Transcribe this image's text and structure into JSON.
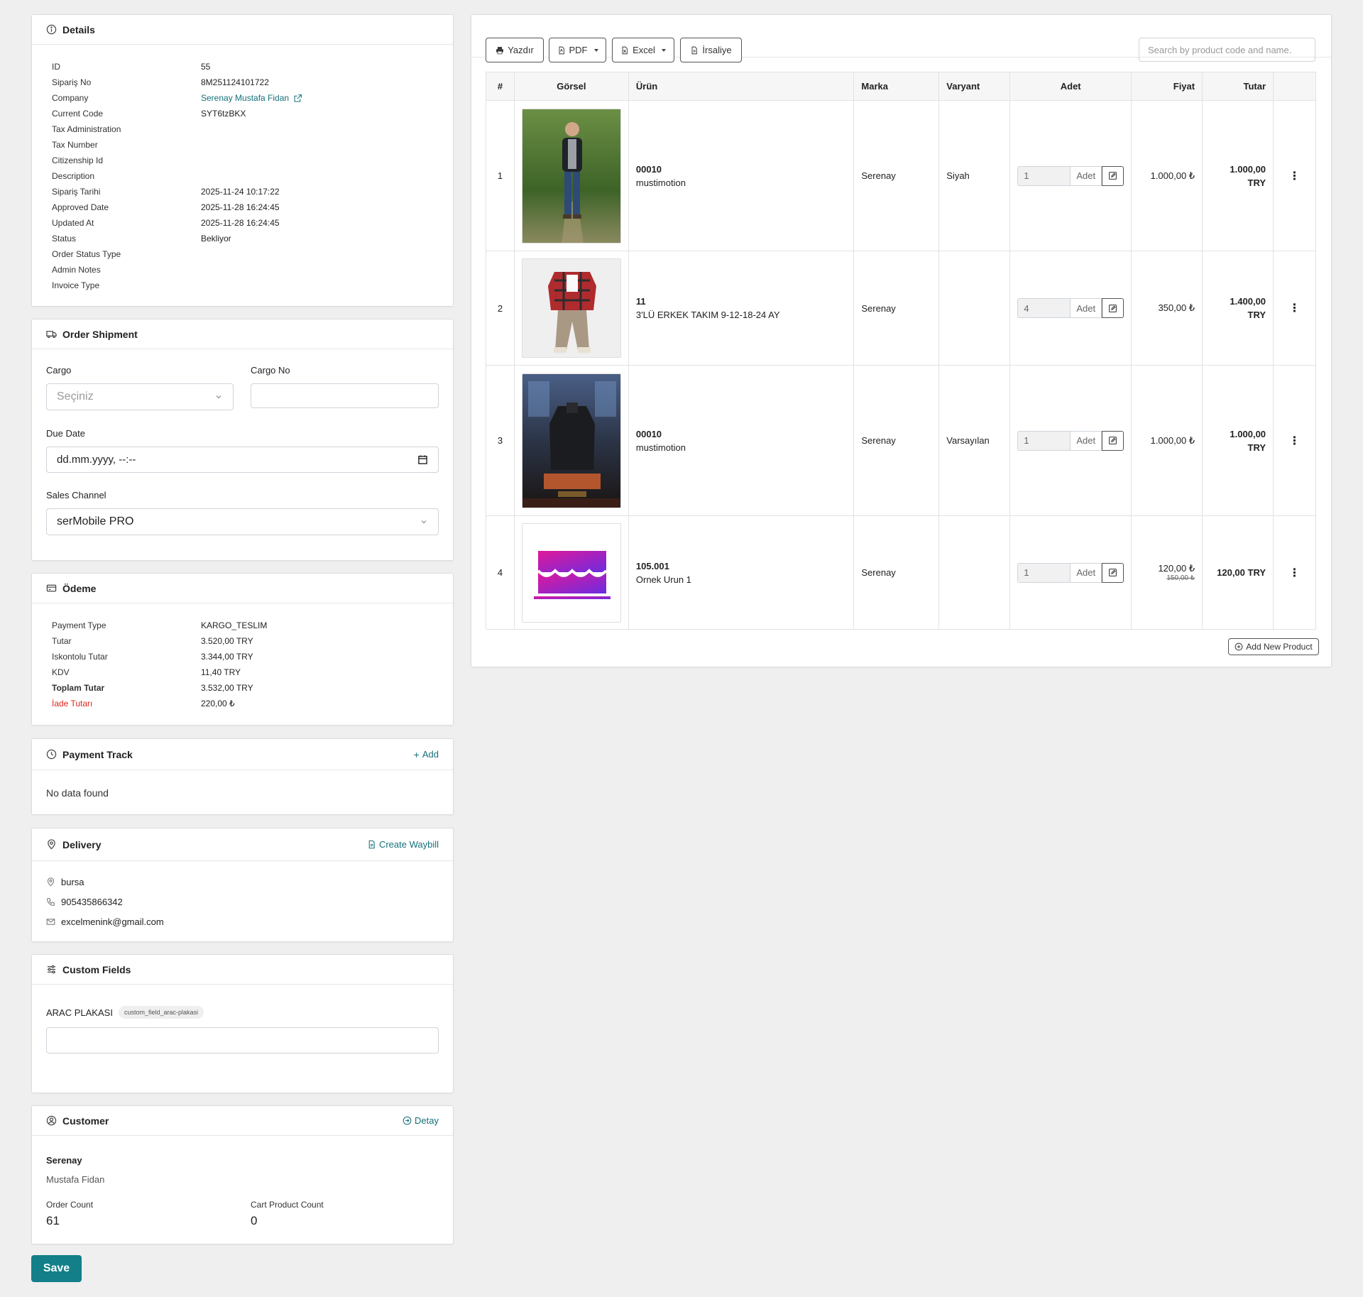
{
  "details": {
    "title": "Details",
    "rows": [
      {
        "key": "ID",
        "value": "55"
      },
      {
        "key": "Sipariş No",
        "value": "8M251124101722"
      },
      {
        "key": "Company",
        "value": "Serenay Mustafa Fidan"
      },
      {
        "key": "Current Code",
        "value": "SYT6tzBKX"
      },
      {
        "key": "Tax Administration",
        "value": ""
      },
      {
        "key": "Tax Number",
        "value": ""
      },
      {
        "key": "Citizenship Id",
        "value": ""
      },
      {
        "key": "Description",
        "value": ""
      },
      {
        "key": "Sipariş Tarihi",
        "value": "2025-11-24 10:17:22"
      },
      {
        "key": "Approved Date",
        "value": "2025-11-28 16:24:45"
      },
      {
        "key": "Updated At",
        "value": "2025-11-28 16:24:45"
      },
      {
        "key": "Status",
        "value": "Bekliyor"
      },
      {
        "key": "Order Status Type",
        "value": ""
      },
      {
        "key": "Admin Notes",
        "value": ""
      },
      {
        "key": "Invoice Type",
        "value": ""
      }
    ]
  },
  "shipment": {
    "title": "Order Shipment",
    "cargo_label": "Cargo",
    "cargo_placeholder": "Seçiniz",
    "cargo_no_label": "Cargo No",
    "cargo_no_value": "",
    "due_date_label": "Due Date",
    "due_date_value": "dd.mm.yyyy, --:--",
    "sales_channel_label": "Sales Channel",
    "sales_channel_value": "serMobile PRO"
  },
  "payment": {
    "title": "Ödeme",
    "rows": [
      {
        "key": "Payment Type",
        "value": "KARGO_TESLIM"
      },
      {
        "key": "Tutar",
        "value": "3.520,00 TRY"
      },
      {
        "key": "Iskontolu Tutar",
        "value": "3.344,00 TRY"
      },
      {
        "key": "KDV",
        "value": "11,40 TRY"
      },
      {
        "key": "Toplam Tutar",
        "value": "3.532,00 TRY"
      },
      {
        "key": "İade Tutarı",
        "value": "220,00 ₺"
      }
    ]
  },
  "payment_track": {
    "title": "Payment Track",
    "add_label": "Add",
    "empty": "No data found"
  },
  "delivery": {
    "title": "Delivery",
    "waybill_label": "Create Waybill",
    "city": "bursa",
    "phone": "905435866342",
    "email": "excelmenink@gmail.com"
  },
  "custom_fields": {
    "title": "Custom Fields",
    "field_label": "ARAC PLAKASI",
    "field_key": "custom_field_arac-plakasi",
    "field_value": ""
  },
  "customer": {
    "title": "Customer",
    "detail_label": "Detay",
    "first_name": "Serenay",
    "last_name": "Mustafa Fidan",
    "order_count_label": "Order Count",
    "order_count": "61",
    "cart_count_label": "Cart Product Count",
    "cart_count": "0"
  },
  "save_label": "Save",
  "toolbar": {
    "print": "Yazdır",
    "pdf": "PDF",
    "excel": "Excel",
    "irsaliye": "İrsaliye",
    "search_placeholder": "Search by product code and name."
  },
  "table": {
    "headers": [
      "#",
      "Görsel",
      "Ürün",
      "Marka",
      "Varyant",
      "Adet",
      "Fiyat",
      "Tutar",
      ""
    ],
    "unit_label": "Adet",
    "rows": [
      {
        "no": "1",
        "code": "00010",
        "name": "mustimotion",
        "brand": "Serenay",
        "variant": "Siyah",
        "qty": "1",
        "price": "1.000,00 ₺",
        "old_price": "",
        "total": "1.000,00 TRY",
        "image": "man-in-forest-photo"
      },
      {
        "no": "2",
        "code": "11",
        "name": "3'LÜ ERKEK TAKIM 9-12-18-24 AY",
        "brand": "Serenay",
        "variant": "",
        "qty": "4",
        "price": "350,00 ₺",
        "old_price": "",
        "total": "1.400,00 TRY",
        "image": "kids-outfit-photo"
      },
      {
        "no": "3",
        "code": "00010",
        "name": "mustimotion",
        "brand": "Serenay",
        "variant": "Varsayılan",
        "qty": "1",
        "price": "1.000,00 ₺",
        "old_price": "",
        "total": "1.000,00 TRY",
        "image": "jacket-store-photo"
      },
      {
        "no": "4",
        "code": "105.001",
        "name": "Ornek Urun 1",
        "brand": "Serenay",
        "variant": "",
        "qty": "1",
        "price": "120,00 ₺",
        "old_price": "150,00 ₺",
        "total": "120,00 TRY",
        "image": "store-icon-graphic"
      }
    ],
    "add_product_label": "Add New Product"
  }
}
